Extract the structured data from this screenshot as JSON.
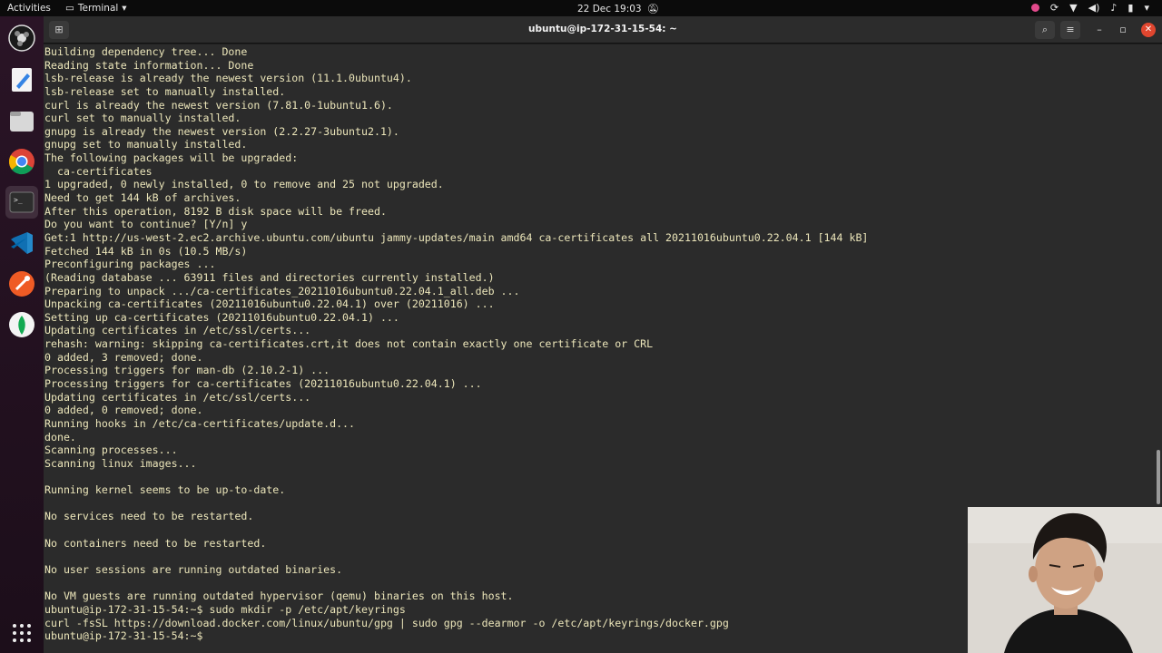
{
  "topbar": {
    "activities": "Activities",
    "app_name": "Terminal",
    "clock": "22 Dec  19:03"
  },
  "window": {
    "title": "ubuntu@ip-172-31-15-54: ~"
  },
  "dock": {
    "items": [
      "obs-icon",
      "text-editor-icon",
      "files-icon",
      "chrome-icon",
      "terminal-icon",
      "vscode-icon",
      "postman-icon",
      "mongodb-compass-icon",
      "app-grid-icon"
    ]
  },
  "terminal": {
    "lines": [
      "Building dependency tree... Done",
      "Reading state information... Done",
      "lsb-release is already the newest version (11.1.0ubuntu4).",
      "lsb-release set to manually installed.",
      "curl is already the newest version (7.81.0-1ubuntu1.6).",
      "curl set to manually installed.",
      "gnupg is already the newest version (2.2.27-3ubuntu2.1).",
      "gnupg set to manually installed.",
      "The following packages will be upgraded:",
      "  ca-certificates",
      "1 upgraded, 0 newly installed, 0 to remove and 25 not upgraded.",
      "Need to get 144 kB of archives.",
      "After this operation, 8192 B disk space will be freed.",
      "Do you want to continue? [Y/n] y",
      "Get:1 http://us-west-2.ec2.archive.ubuntu.com/ubuntu jammy-updates/main amd64 ca-certificates all 20211016ubuntu0.22.04.1 [144 kB]",
      "Fetched 144 kB in 0s (10.5 MB/s)",
      "Preconfiguring packages ...",
      "(Reading database ... 63911 files and directories currently installed.)",
      "Preparing to unpack .../ca-certificates_20211016ubuntu0.22.04.1_all.deb ...",
      "Unpacking ca-certificates (20211016ubuntu0.22.04.1) over (20211016) ...",
      "Setting up ca-certificates (20211016ubuntu0.22.04.1) ...",
      "Updating certificates in /etc/ssl/certs...",
      "rehash: warning: skipping ca-certificates.crt,it does not contain exactly one certificate or CRL",
      "0 added, 3 removed; done.",
      "Processing triggers for man-db (2.10.2-1) ...",
      "Processing triggers for ca-certificates (20211016ubuntu0.22.04.1) ...",
      "Updating certificates in /etc/ssl/certs...",
      "0 added, 0 removed; done.",
      "Running hooks in /etc/ca-certificates/update.d...",
      "done.",
      "Scanning processes...",
      "Scanning linux images...",
      "",
      "Running kernel seems to be up-to-date.",
      "",
      "No services need to be restarted.",
      "",
      "No containers need to be restarted.",
      "",
      "No user sessions are running outdated binaries.",
      "",
      "No VM guests are running outdated hypervisor (qemu) binaries on this host.",
      "ubuntu@ip-172-31-15-54:~$ sudo mkdir -p /etc/apt/keyrings",
      "curl -fsSL https://download.docker.com/linux/ubuntu/gpg | sudo gpg --dearmor -o /etc/apt/keyrings/docker.gpg",
      "ubuntu@ip-172-31-15-54:~$ "
    ]
  }
}
